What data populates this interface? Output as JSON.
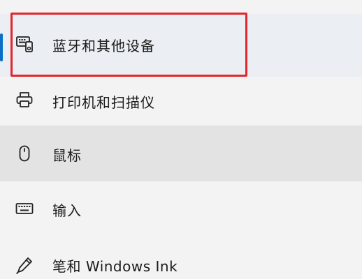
{
  "nav": {
    "items": [
      {
        "id": "bluetooth",
        "label": "蓝牙和其他设备",
        "icon": "devices-icon",
        "selected": true,
        "highlighted": true
      },
      {
        "id": "printers",
        "label": "打印机和扫描仪",
        "icon": "printer-icon",
        "selected": false
      },
      {
        "id": "mouse",
        "label": "鼠标",
        "icon": "mouse-icon",
        "selected": false,
        "hovered": true
      },
      {
        "id": "typing",
        "label": "输入",
        "icon": "keyboard-icon",
        "selected": false
      },
      {
        "id": "pen",
        "label": "笔和 Windows Ink",
        "icon": "pen-icon",
        "selected": false
      }
    ]
  },
  "colors": {
    "accent": "#0a6fc9",
    "highlight_border": "#e2262c",
    "selected_bg": "#ebeef3",
    "hover_bg": "#e3e3e3",
    "page_bg": "#f3f3f3"
  }
}
